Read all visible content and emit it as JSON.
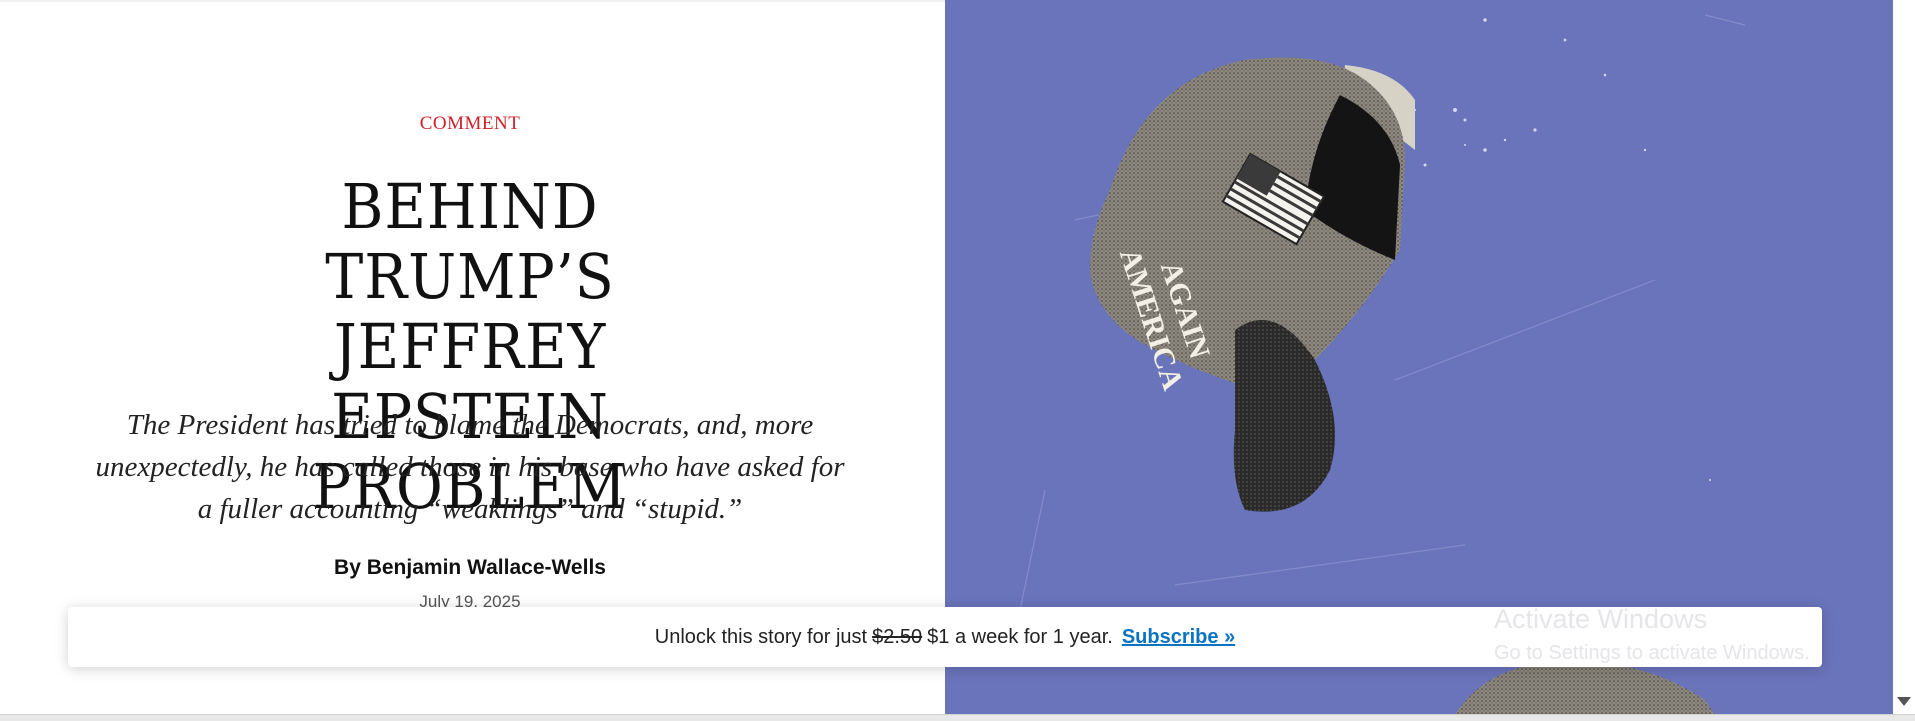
{
  "article": {
    "rubric": "COMMENT",
    "headline_lines": [
      "BEHIND TRUMP’S",
      "JEFFREY EPSTEIN",
      "PROBLEM"
    ],
    "dek_lines": [
      "The President has tried to blame the Democrats, and, more",
      "unexpectedly, he has called those in his base who have asked for",
      "a fuller accounting “weaklings” and “stupid.”"
    ],
    "byline": "By Benjamin Wallace-Wells",
    "date": "July 19, 2025"
  },
  "illustration": {
    "description_icon": "maga-hat-illustration",
    "hat_text_lines": [
      "AMERICA",
      "AGAIN"
    ],
    "background_color": "#6a74bb"
  },
  "paywall": {
    "prefix": "Unlock this story for just",
    "old_price": "$2.50",
    "offer": "$1 a week for 1 year.",
    "subscribe_label": "Subscribe »"
  },
  "watermark": {
    "title": "Activate Windows",
    "subtitle": "Go to Settings to activate Windows."
  },
  "colors": {
    "rubric": "#d0202a",
    "link": "#0a73c2"
  }
}
